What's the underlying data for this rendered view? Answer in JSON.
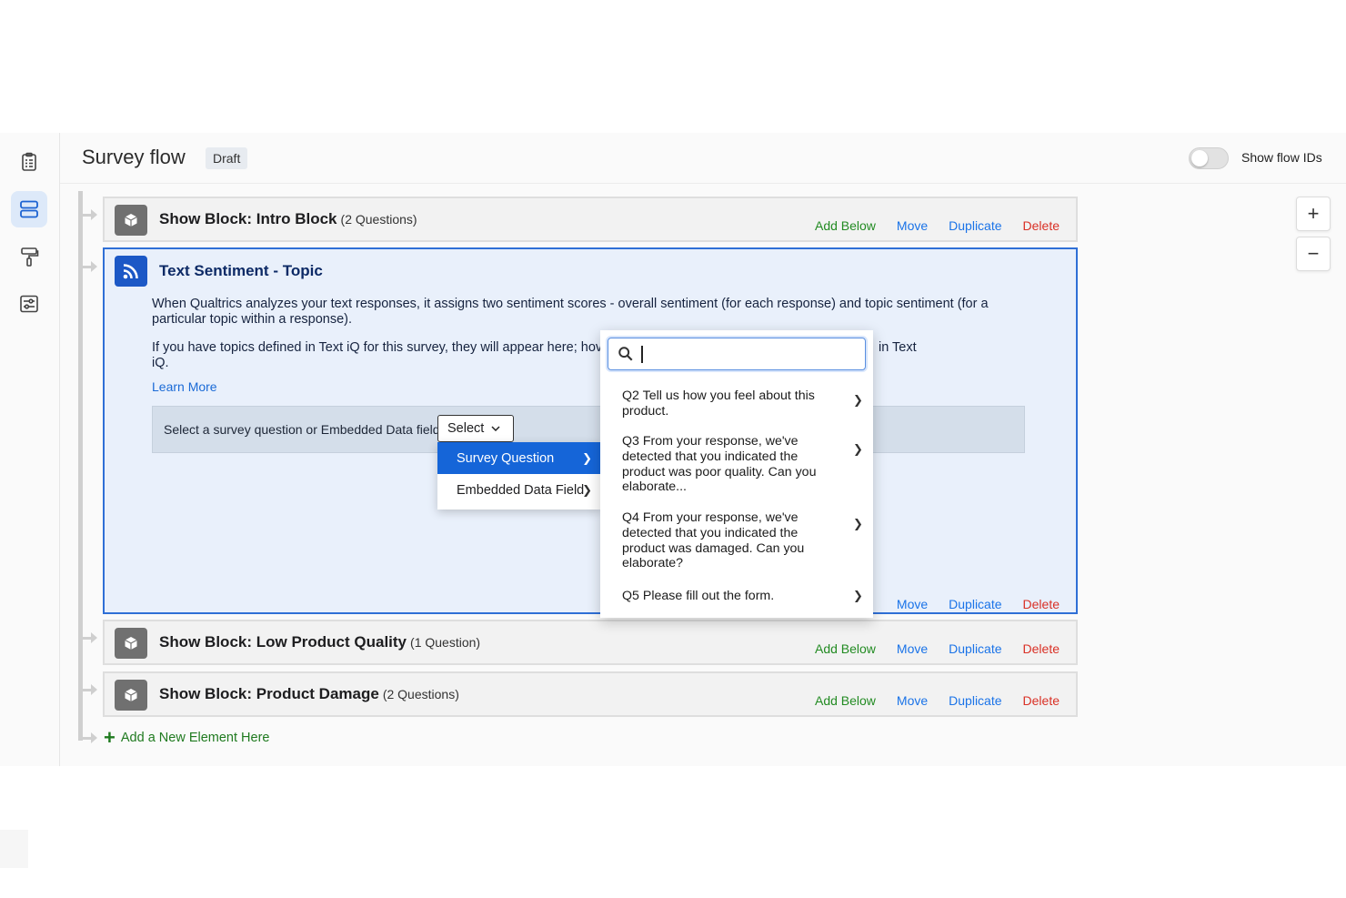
{
  "header": {
    "title": "Survey flow",
    "status_badge": "Draft",
    "toggle_label": "Show flow IDs",
    "toggle_on": false
  },
  "left_rail": {
    "icons": [
      "survey-clipboard-icon",
      "survey-flow-icon",
      "look-and-feel-brush-icon",
      "survey-options-icon"
    ],
    "active": "survey-flow-icon"
  },
  "zoom": {
    "in_label": "+",
    "out_label": "−"
  },
  "actions": {
    "add_below": "Add Below",
    "move": "Move",
    "duplicate": "Duplicate",
    "delete": "Delete"
  },
  "blocks": [
    {
      "title": "Show Block: Intro Block",
      "count": "(2 Questions)"
    },
    {
      "title": "Show Block: Low Product Quality",
      "count": "(1 Question)"
    },
    {
      "title": "Show Block: Product Damage",
      "count": "(2 Questions)"
    }
  ],
  "sentiment": {
    "title": "Text Sentiment - Topic",
    "para1": "When Qualtrics analyzes your text responses, it assigns two sentiment scores - overall sentiment (for each response) and topic sentiment (for a particular topic within a response).",
    "para2_left": "If you have topics defined in Text iQ for this survey, they will appear here; hov",
    "para2_right": "in Text",
    "para2_end": "iQ.",
    "learn_more": "Learn More",
    "select_label": "Select a survey question or Embedded Data field",
    "select_button": "Select"
  },
  "field_menu": {
    "items": [
      "Survey Question",
      "Embedded Data Field"
    ],
    "selected": "Survey Question"
  },
  "question_menu": {
    "search_value": "",
    "questions": [
      "Q2 Tell us how you feel about this product.",
      "Q3 From your response, we've detected that you indicated the product was poor quality. Can you elaborate...",
      "Q4 From your response, we've detected that you indicated the product was damaged. Can you elaborate?",
      "Q5 Please fill out the form."
    ]
  },
  "add_element": "Add a New Element Here",
  "colors": {
    "accent_blue": "#1a73e8",
    "add_green": "#228b22",
    "delete_red": "#d93025",
    "selected_menu": "#1565d8",
    "sentiment_bg": "#e9f0fb"
  }
}
